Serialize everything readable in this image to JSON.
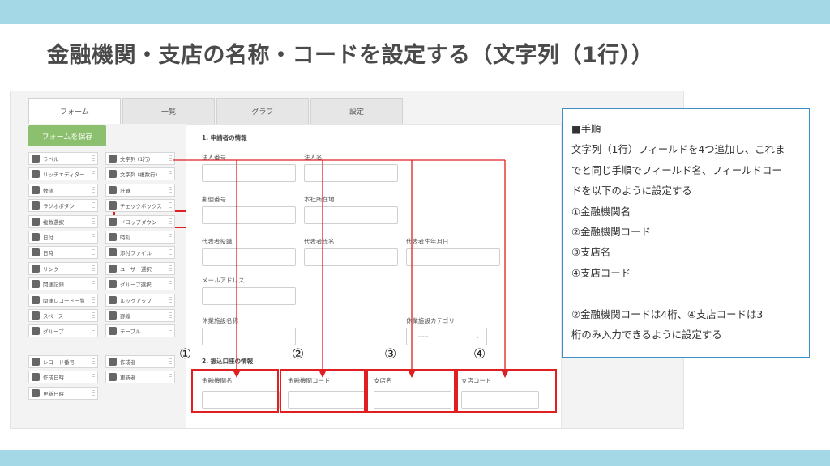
{
  "slide": {
    "title": "金融機関・支店の名称・コードを設定する（文字列（1行））"
  },
  "app": {
    "tabs": [
      {
        "label": "フォーム"
      },
      {
        "label": "一覧"
      },
      {
        "label": "グラフ"
      },
      {
        "label": "設定"
      }
    ],
    "save_button": "フォームを保存",
    "palette_left": [
      "ラベル",
      "リッチエディター",
      "数値",
      "ラジオボタン",
      "複数選択",
      "日付",
      "日時",
      "リンク",
      "関連記録",
      "関連レコード一覧",
      "スペース",
      "グループ",
      "レコード番号",
      "作成日時",
      "更新日時"
    ],
    "palette_right": [
      "文字列 (1行)",
      "文字列 (複数行)",
      "計算",
      "チェックボックス",
      "ドロップダウン",
      "時刻",
      "添付ファイル",
      "ユーザー選択",
      "グループ選択",
      "ルックアップ",
      "罫線",
      "テーブル",
      "作成者",
      "更新者"
    ],
    "section1_title": "1. 申請者の情報",
    "section1_fields": [
      "法人番号",
      "法人名",
      "郵便番号",
      "本社所在地",
      "代表者役職",
      "代表者氏名",
      "代表者生年月日",
      "メールアドレス",
      "休業施設名称",
      "休業施設カテゴリ"
    ],
    "category_select_value": "-----",
    "section2_title": "2. 振込口座の情報",
    "section2_fields": [
      "金融機関名",
      "金融機関コード",
      "支店名",
      "支店コード"
    ]
  },
  "markers": [
    "①",
    "②",
    "③",
    "④"
  ],
  "note": {
    "lines": [
      "■手順",
      "文字列（1行）フィールドを4つ追加し、これま",
      "でと同じ手順でフィールド名、フィールドコー",
      "ドを以下のように設定する",
      "①金融機関名",
      "②金融機関コード",
      "③支店名",
      "④支店コード",
      "",
      "②金融機関コードは4桁、④支店コードは3",
      "桁のみ入力できるように設定する"
    ]
  },
  "colors": {
    "band": "#a5d8e6",
    "highlight": "#e02020",
    "save_button": "#8dc06e",
    "note_border": "#3b8fc4"
  }
}
